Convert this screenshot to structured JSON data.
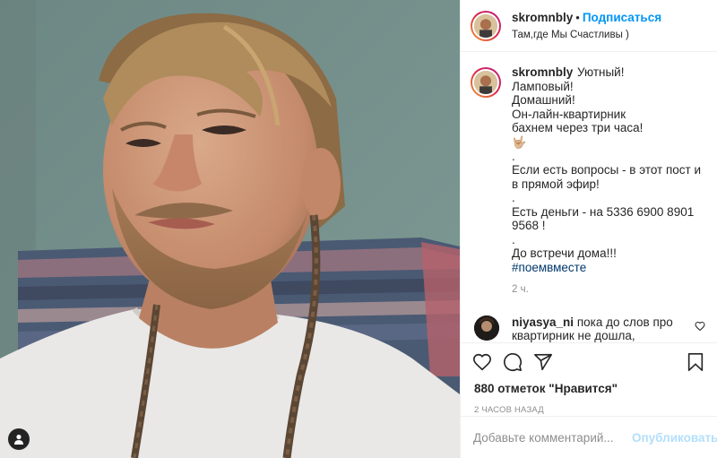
{
  "header": {
    "username": "skromnbly",
    "separator": "•",
    "follow_label": "Подписаться",
    "location": "Там,где Мы Счастливы )"
  },
  "caption": {
    "username": "skromnbly",
    "lines_part1": "Уютный!\nЛамповый!\nДомашний!\nОн-лайн-квартирник\nбахнем через три часа!",
    "emoji": "🤟🏼",
    "lines_part2": ".\nЕсли есть вопросы - в этот пост и в прямой эфир!\n.\nЕсть деньги - на 5336 6900 8901 9568 !\n.\nДо встречи дома!!!",
    "hashtag": "#поемвместе",
    "time_ago": "2 ч."
  },
  "comment": {
    "username": "niyasya_ni",
    "text": "пока до слов про квартирник не дошла, думалось"
  },
  "actions": {
    "likes": "880 отметок \"Нравится\"",
    "date": "2 ЧАСОВ НАЗАД"
  },
  "add_comment": {
    "placeholder": "Добавьте комментарий...",
    "post_label": "Опубликовать"
  },
  "colors": {
    "accent": "#0095f6",
    "post_disabled": "#b2dffc",
    "hashtag": "#00376b",
    "muted": "#8e8e8e"
  },
  "icons": [
    "user-tag-icon",
    "heart-icon",
    "comment-icon",
    "share-icon",
    "bookmark-icon",
    "heart-small-icon"
  ]
}
